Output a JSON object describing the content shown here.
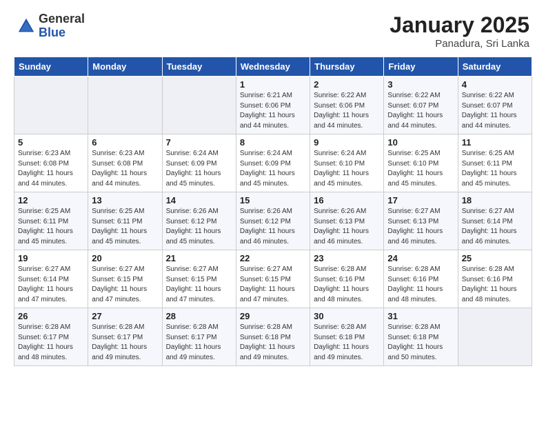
{
  "header": {
    "logo_general": "General",
    "logo_blue": "Blue",
    "month_title": "January 2025",
    "subtitle": "Panadura, Sri Lanka"
  },
  "weekdays": [
    "Sunday",
    "Monday",
    "Tuesday",
    "Wednesday",
    "Thursday",
    "Friday",
    "Saturday"
  ],
  "weeks": [
    [
      {
        "day": "",
        "info": ""
      },
      {
        "day": "",
        "info": ""
      },
      {
        "day": "",
        "info": ""
      },
      {
        "day": "1",
        "info": "Sunrise: 6:21 AM\nSunset: 6:06 PM\nDaylight: 11 hours and 44 minutes."
      },
      {
        "day": "2",
        "info": "Sunrise: 6:22 AM\nSunset: 6:06 PM\nDaylight: 11 hours and 44 minutes."
      },
      {
        "day": "3",
        "info": "Sunrise: 6:22 AM\nSunset: 6:07 PM\nDaylight: 11 hours and 44 minutes."
      },
      {
        "day": "4",
        "info": "Sunrise: 6:22 AM\nSunset: 6:07 PM\nDaylight: 11 hours and 44 minutes."
      }
    ],
    [
      {
        "day": "5",
        "info": "Sunrise: 6:23 AM\nSunset: 6:08 PM\nDaylight: 11 hours and 44 minutes."
      },
      {
        "day": "6",
        "info": "Sunrise: 6:23 AM\nSunset: 6:08 PM\nDaylight: 11 hours and 44 minutes."
      },
      {
        "day": "7",
        "info": "Sunrise: 6:24 AM\nSunset: 6:09 PM\nDaylight: 11 hours and 45 minutes."
      },
      {
        "day": "8",
        "info": "Sunrise: 6:24 AM\nSunset: 6:09 PM\nDaylight: 11 hours and 45 minutes."
      },
      {
        "day": "9",
        "info": "Sunrise: 6:24 AM\nSunset: 6:10 PM\nDaylight: 11 hours and 45 minutes."
      },
      {
        "day": "10",
        "info": "Sunrise: 6:25 AM\nSunset: 6:10 PM\nDaylight: 11 hours and 45 minutes."
      },
      {
        "day": "11",
        "info": "Sunrise: 6:25 AM\nSunset: 6:11 PM\nDaylight: 11 hours and 45 minutes."
      }
    ],
    [
      {
        "day": "12",
        "info": "Sunrise: 6:25 AM\nSunset: 6:11 PM\nDaylight: 11 hours and 45 minutes."
      },
      {
        "day": "13",
        "info": "Sunrise: 6:25 AM\nSunset: 6:11 PM\nDaylight: 11 hours and 45 minutes."
      },
      {
        "day": "14",
        "info": "Sunrise: 6:26 AM\nSunset: 6:12 PM\nDaylight: 11 hours and 45 minutes."
      },
      {
        "day": "15",
        "info": "Sunrise: 6:26 AM\nSunset: 6:12 PM\nDaylight: 11 hours and 46 minutes."
      },
      {
        "day": "16",
        "info": "Sunrise: 6:26 AM\nSunset: 6:13 PM\nDaylight: 11 hours and 46 minutes."
      },
      {
        "day": "17",
        "info": "Sunrise: 6:27 AM\nSunset: 6:13 PM\nDaylight: 11 hours and 46 minutes."
      },
      {
        "day": "18",
        "info": "Sunrise: 6:27 AM\nSunset: 6:14 PM\nDaylight: 11 hours and 46 minutes."
      }
    ],
    [
      {
        "day": "19",
        "info": "Sunrise: 6:27 AM\nSunset: 6:14 PM\nDaylight: 11 hours and 47 minutes."
      },
      {
        "day": "20",
        "info": "Sunrise: 6:27 AM\nSunset: 6:15 PM\nDaylight: 11 hours and 47 minutes."
      },
      {
        "day": "21",
        "info": "Sunrise: 6:27 AM\nSunset: 6:15 PM\nDaylight: 11 hours and 47 minutes."
      },
      {
        "day": "22",
        "info": "Sunrise: 6:27 AM\nSunset: 6:15 PM\nDaylight: 11 hours and 47 minutes."
      },
      {
        "day": "23",
        "info": "Sunrise: 6:28 AM\nSunset: 6:16 PM\nDaylight: 11 hours and 48 minutes."
      },
      {
        "day": "24",
        "info": "Sunrise: 6:28 AM\nSunset: 6:16 PM\nDaylight: 11 hours and 48 minutes."
      },
      {
        "day": "25",
        "info": "Sunrise: 6:28 AM\nSunset: 6:16 PM\nDaylight: 11 hours and 48 minutes."
      }
    ],
    [
      {
        "day": "26",
        "info": "Sunrise: 6:28 AM\nSunset: 6:17 PM\nDaylight: 11 hours and 48 minutes."
      },
      {
        "day": "27",
        "info": "Sunrise: 6:28 AM\nSunset: 6:17 PM\nDaylight: 11 hours and 49 minutes."
      },
      {
        "day": "28",
        "info": "Sunrise: 6:28 AM\nSunset: 6:17 PM\nDaylight: 11 hours and 49 minutes."
      },
      {
        "day": "29",
        "info": "Sunrise: 6:28 AM\nSunset: 6:18 PM\nDaylight: 11 hours and 49 minutes."
      },
      {
        "day": "30",
        "info": "Sunrise: 6:28 AM\nSunset: 6:18 PM\nDaylight: 11 hours and 49 minutes."
      },
      {
        "day": "31",
        "info": "Sunrise: 6:28 AM\nSunset: 6:18 PM\nDaylight: 11 hours and 50 minutes."
      },
      {
        "day": "",
        "info": ""
      }
    ]
  ]
}
